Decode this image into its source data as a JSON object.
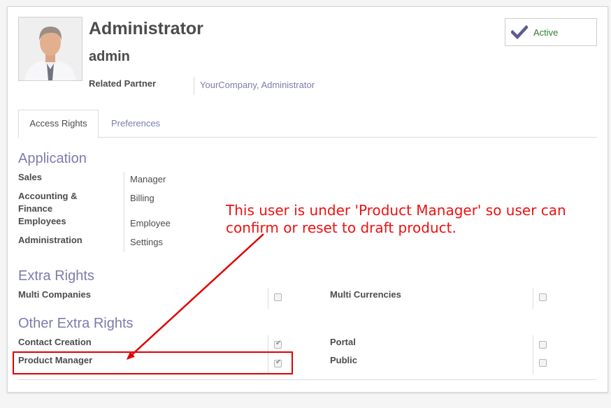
{
  "user": {
    "name": "Administrator",
    "login": "admin",
    "related_partner_label": "Related Partner",
    "related_partner_value": "YourCompany, Administrator",
    "status_button": "Active"
  },
  "tabs": [
    {
      "label": "Access Rights",
      "active": true
    },
    {
      "label": "Preferences",
      "active": false
    }
  ],
  "application": {
    "title": "Application",
    "rows": [
      {
        "label": "Sales",
        "value": "Manager"
      },
      {
        "label": "Accounting & Finance",
        "value": "Billing"
      },
      {
        "label": "Employees",
        "value": "Employee"
      },
      {
        "label": "Administration",
        "value": "Settings"
      }
    ]
  },
  "extra_rights": {
    "title": "Extra Rights",
    "items": [
      {
        "label": "Multi Companies",
        "checked": false
      },
      {
        "label": "Multi Currencies",
        "checked": false
      }
    ]
  },
  "other_extra_rights": {
    "title": "Other Extra Rights",
    "items": [
      {
        "label": "Contact Creation",
        "checked": true
      },
      {
        "label": "Portal",
        "checked": false
      },
      {
        "label": "Product Manager",
        "checked": true
      },
      {
        "label": "Public",
        "checked": false
      }
    ]
  },
  "annotation": {
    "text": "This user is under 'Product Manager' so user can confirm or reset to draft product.",
    "color": "#ee1111"
  },
  "colors": {
    "accent": "#7c7bad",
    "active_check": "#5b5b8f"
  },
  "icons": {
    "status": "check-icon",
    "checkbox_tick": "checkmark-icon"
  }
}
